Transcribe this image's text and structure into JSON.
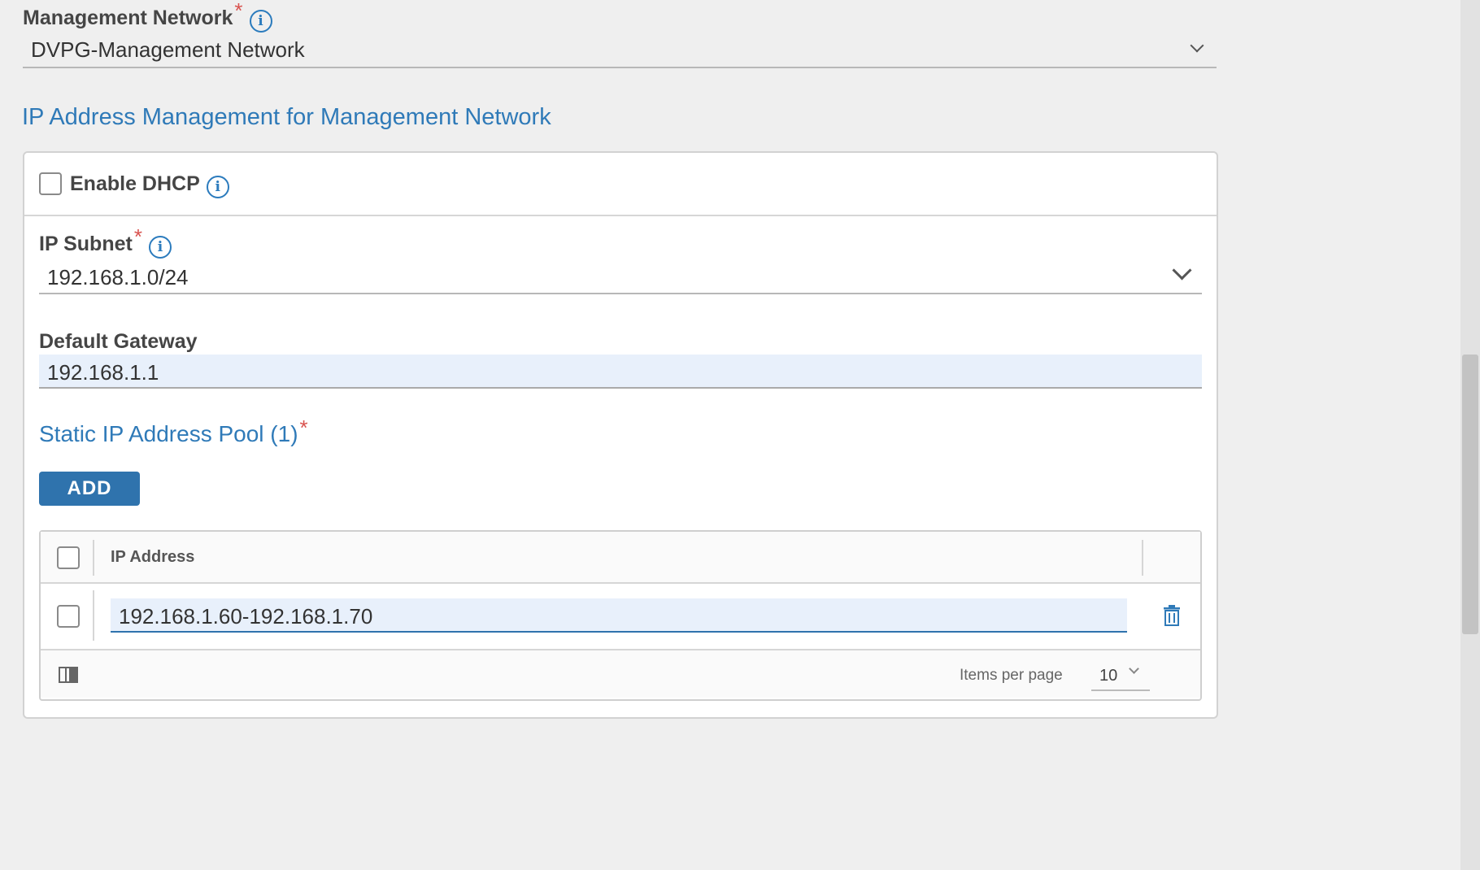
{
  "management_network": {
    "label": "Management Network",
    "required_mark": "*",
    "info_icon": "info-icon",
    "selected": "DVPG-Management Network"
  },
  "ipam_section": {
    "title": "IP Address Management for Management Network"
  },
  "dhcp": {
    "label": "Enable DHCP",
    "checked": false
  },
  "ip_subnet": {
    "label": "IP Subnet",
    "required_mark": "*",
    "selected": "192.168.1.0/24"
  },
  "default_gateway": {
    "label": "Default Gateway",
    "value": "192.168.1.1"
  },
  "static_pool": {
    "title": "Static IP Address Pool (1)",
    "required_mark": "*",
    "add_label": "ADD",
    "columns": [
      "IP Address"
    ],
    "rows": [
      {
        "ip_address": "192.168.1.60-192.168.1.70"
      }
    ],
    "footer": {
      "items_per_page_label": "Items per page",
      "items_per_page_value": "10"
    }
  },
  "colors": {
    "accent": "#2f7ab8",
    "button": "#2f73ad",
    "required": "#d9534f",
    "input_bg": "#e8f0fb"
  },
  "icons": {
    "delete": "trash-icon",
    "columns": "column-toggle-icon",
    "dropdown": "chevron-down-icon"
  }
}
